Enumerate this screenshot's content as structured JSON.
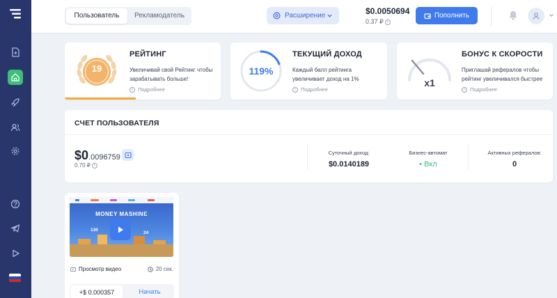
{
  "topbar": {
    "role_tabs": [
      "Пользователь",
      "Рекламодатель"
    ],
    "extension_label": "Расширение",
    "balance_usd": "$0.0050694",
    "balance_rub": "0.37 ₽",
    "topup_label": "Пополнить"
  },
  "cards": {
    "rating": {
      "title": "РЕЙТИНГ",
      "value": "19",
      "desc": "Увеличивай свой Рейтинг чтобы зарабатывать больше!",
      "more": "Подробнее"
    },
    "income": {
      "title": "ТЕКУЩИЙ ДОХОД",
      "value": "119%",
      "desc": "Каждый балл рейтинга увеличивает доход на 1%",
      "more": "Подробнее"
    },
    "speed": {
      "title": "БОНУС К СКОРОСТИ",
      "value": "x1",
      "desc": "Приглашай рефералов чтобы рейтинг увеличивался быстрее",
      "more": "Подробнее"
    }
  },
  "account": {
    "title": "СЧЕТ ПОЛЬЗОВАТЕЛЯ",
    "amount_main": "$0",
    "amount_fraction": ".0096759",
    "amount_rub": "0.70 ₽",
    "daily_label": "Суточный доход:",
    "daily_value": "$0.0140189",
    "auto_label": "Бизнес-автомат",
    "auto_value": "• Вкл",
    "refs_label": "Активных рефералов:",
    "refs_value": "0"
  },
  "video": {
    "brand": "MONEY MASHINE",
    "stat_left": "130",
    "stat_right": "24",
    "type_label": "Просмотр видео",
    "duration": "20 сек.",
    "reward": "+$ 0.000357",
    "start_label": "Начать"
  },
  "colors": {
    "sidebar": "#28366b",
    "accent": "#3f7bec",
    "green": "#3dbf7a",
    "rating_gold": "#f2a93b"
  }
}
